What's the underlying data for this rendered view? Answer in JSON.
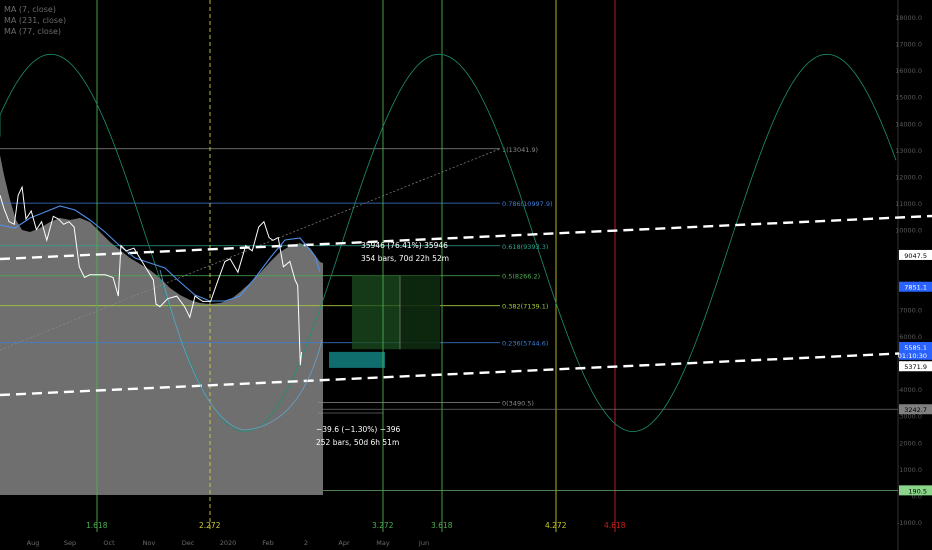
{
  "legend": [
    "MA (7, close)",
    "MA (231, close)",
    "MA (77, close)"
  ],
  "chart_data": {
    "type": "line",
    "x_labels": [
      "Aug",
      "Sep",
      "Oct",
      "Nov",
      "Dec",
      "2020",
      "Feb",
      "2",
      "Apr",
      "May",
      "Jun"
    ],
    "y_ticks": [
      18000,
      17000,
      16000,
      15000,
      14000,
      13000,
      12000,
      11000,
      10000,
      9000,
      8000,
      7000,
      6000,
      5000,
      4000,
      3000,
      2000,
      1000,
      0,
      -1000
    ],
    "y_tick_labels": [
      "18000.0",
      "17000.0",
      "16000.0",
      "15000.0",
      "14000.0",
      "13000.0",
      "12000.0",
      "11000.0",
      "10000.0",
      "9000.0",
      "8000.0",
      "7000.0",
      "6000.0",
      "5000.0",
      "4000.0",
      "3000.0",
      "2000.0",
      "1000.0",
      "0.0",
      "-1000.0"
    ],
    "ylim": [
      -1500,
      18700
    ],
    "price_badges": [
      {
        "label": "9047.5",
        "value": 9047.5,
        "color": "#ffffff",
        "text_color": "#000000"
      },
      {
        "label": "7851.1",
        "value": 7851.1,
        "color": "#2962ff",
        "text_color": "#ffffff"
      },
      {
        "label": "5585.1",
        "value": 5585.1,
        "color": "#2962ff",
        "text_color": "#ffffff"
      },
      {
        "label": "01:10:30",
        "value": 5290,
        "color": "#2962ff",
        "text_color": "#ffffff"
      },
      {
        "label": "5371.9",
        "value": 4860,
        "color": "#ffffff",
        "text_color": "#000000"
      },
      {
        "label": "3242.7",
        "value": 3242.7,
        "color": "#808080",
        "text_color": "#000000"
      },
      {
        "label": "190.5",
        "value": 190.5,
        "color": "#8bd58b",
        "text_color": "#000000"
      }
    ],
    "fib_levels": [
      {
        "label": "1(13041.9)",
        "value": 13041.9,
        "color": "#8a8a8a"
      },
      {
        "label": "0.786(10997.9)",
        "value": 10997.9,
        "color": "#3d7fd6"
      },
      {
        "label": "0.618(9393.3)",
        "value": 9393.3,
        "color": "#2ba58f"
      },
      {
        "label": "0.5(8266.2)",
        "value": 8266.2,
        "color": "#4caf50"
      },
      {
        "label": "0.382(7139.1)",
        "value": 7139.1,
        "color": "#a5c93a"
      },
      {
        "label": "0.236(5744.6)",
        "value": 5744.6,
        "color": "#3d7fd6"
      },
      {
        "label": "0(3490.5)",
        "value": 3490.5,
        "color": "#8a8a8a"
      }
    ],
    "vertical_lines": [
      {
        "label": "1.618",
        "color": "#4caf50",
        "style": "solid"
      },
      {
        "label": "2.272",
        "color": "#d4cc3a",
        "style": "dashed"
      },
      {
        "label": "3.272",
        "color": "#4caf50",
        "style": "solid"
      },
      {
        "label": "3.618",
        "color": "#4caf50",
        "style": "solid"
      },
      {
        "label": "4.272",
        "color": "#c8c81e",
        "style": "solid"
      },
      {
        "label": "4.618",
        "color": "#d01e1e",
        "style": "solid"
      }
    ],
    "annotations": [
      {
        "text": "35946 (76.41%) 35946"
      },
      {
        "text": "354 bars, 70d 22h 52m"
      },
      {
        "text": "−39.6 (−1.30%) −396"
      },
      {
        "text": "252 bars, 50d 6h 51m"
      }
    ],
    "price_series": [
      {
        "x": "Jul 25",
        "y": 11300
      },
      {
        "x": "Jul 28",
        "y": 10800
      },
      {
        "x": "Aug 1",
        "y": 10300
      },
      {
        "x": "Aug 5",
        "y": 10200
      },
      {
        "x": "Aug 8",
        "y": 11300
      },
      {
        "x": "Aug 11",
        "y": 11600
      },
      {
        "x": "Aug 14",
        "y": 10400
      },
      {
        "x": "Aug 18",
        "y": 10700
      },
      {
        "x": "Aug 22",
        "y": 10000
      },
      {
        "x": "Aug 26",
        "y": 10300
      },
      {
        "x": "Aug 30",
        "y": 9600
      },
      {
        "x": "Sep 4",
        "y": 10500
      },
      {
        "x": "Sep 8",
        "y": 10400
      },
      {
        "x": "Sep 12",
        "y": 10200
      },
      {
        "x": "Sep 16",
        "y": 10300
      },
      {
        "x": "Sep 20",
        "y": 10100
      },
      {
        "x": "Sep 24",
        "y": 8600
      },
      {
        "x": "Sep 28",
        "y": 8200
      },
      {
        "x": "Oct 2",
        "y": 8300
      },
      {
        "x": "Oct 8",
        "y": 8300
      },
      {
        "x": "Oct 14",
        "y": 8300
      },
      {
        "x": "Oct 20",
        "y": 8200
      },
      {
        "x": "Oct 24",
        "y": 7500
      },
      {
        "x": "Oct 26",
        "y": 9400
      },
      {
        "x": "Oct 30",
        "y": 9200
      },
      {
        "x": "Nov 5",
        "y": 9300
      },
      {
        "x": "Nov 10",
        "y": 8900
      },
      {
        "x": "Nov 15",
        "y": 8500
      },
      {
        "x": "Nov 20",
        "y": 8100
      },
      {
        "x": "Nov 22",
        "y": 7200
      },
      {
        "x": "Nov 25",
        "y": 7100
      },
      {
        "x": "Dec 1",
        "y": 7400
      },
      {
        "x": "Dec 8",
        "y": 7500
      },
      {
        "x": "Dec 14",
        "y": 7100
      },
      {
        "x": "Dec 18",
        "y": 6700
      },
      {
        "x": "Dec 22",
        "y": 7500
      },
      {
        "x": "Dec 28",
        "y": 7300
      },
      {
        "x": "Jan 3",
        "y": 7300
      },
      {
        "x": "Jan 8",
        "y": 8000
      },
      {
        "x": "Jan 14",
        "y": 8800
      },
      {
        "x": "Jan 18",
        "y": 8900
      },
      {
        "x": "Jan 24",
        "y": 8400
      },
      {
        "x": "Jan 30",
        "y": 9400
      },
      {
        "x": "Feb 4",
        "y": 9200
      },
      {
        "x": "Feb 9",
        "y": 10100
      },
      {
        "x": "Feb 13",
        "y": 10300
      },
      {
        "x": "Feb 17",
        "y": 9700
      },
      {
        "x": "Feb 20",
        "y": 9600
      },
      {
        "x": "Feb 24",
        "y": 9700
      },
      {
        "x": "Feb 28",
        "y": 8600
      },
      {
        "x": "Mar 4",
        "y": 8800
      },
      {
        "x": "Mar 8",
        "y": 8100
      },
      {
        "x": "Mar 10",
        "y": 7900
      },
      {
        "x": "Mar 12",
        "y": 4900
      },
      {
        "x": "Mar 13",
        "y": 5400
      }
    ]
  }
}
